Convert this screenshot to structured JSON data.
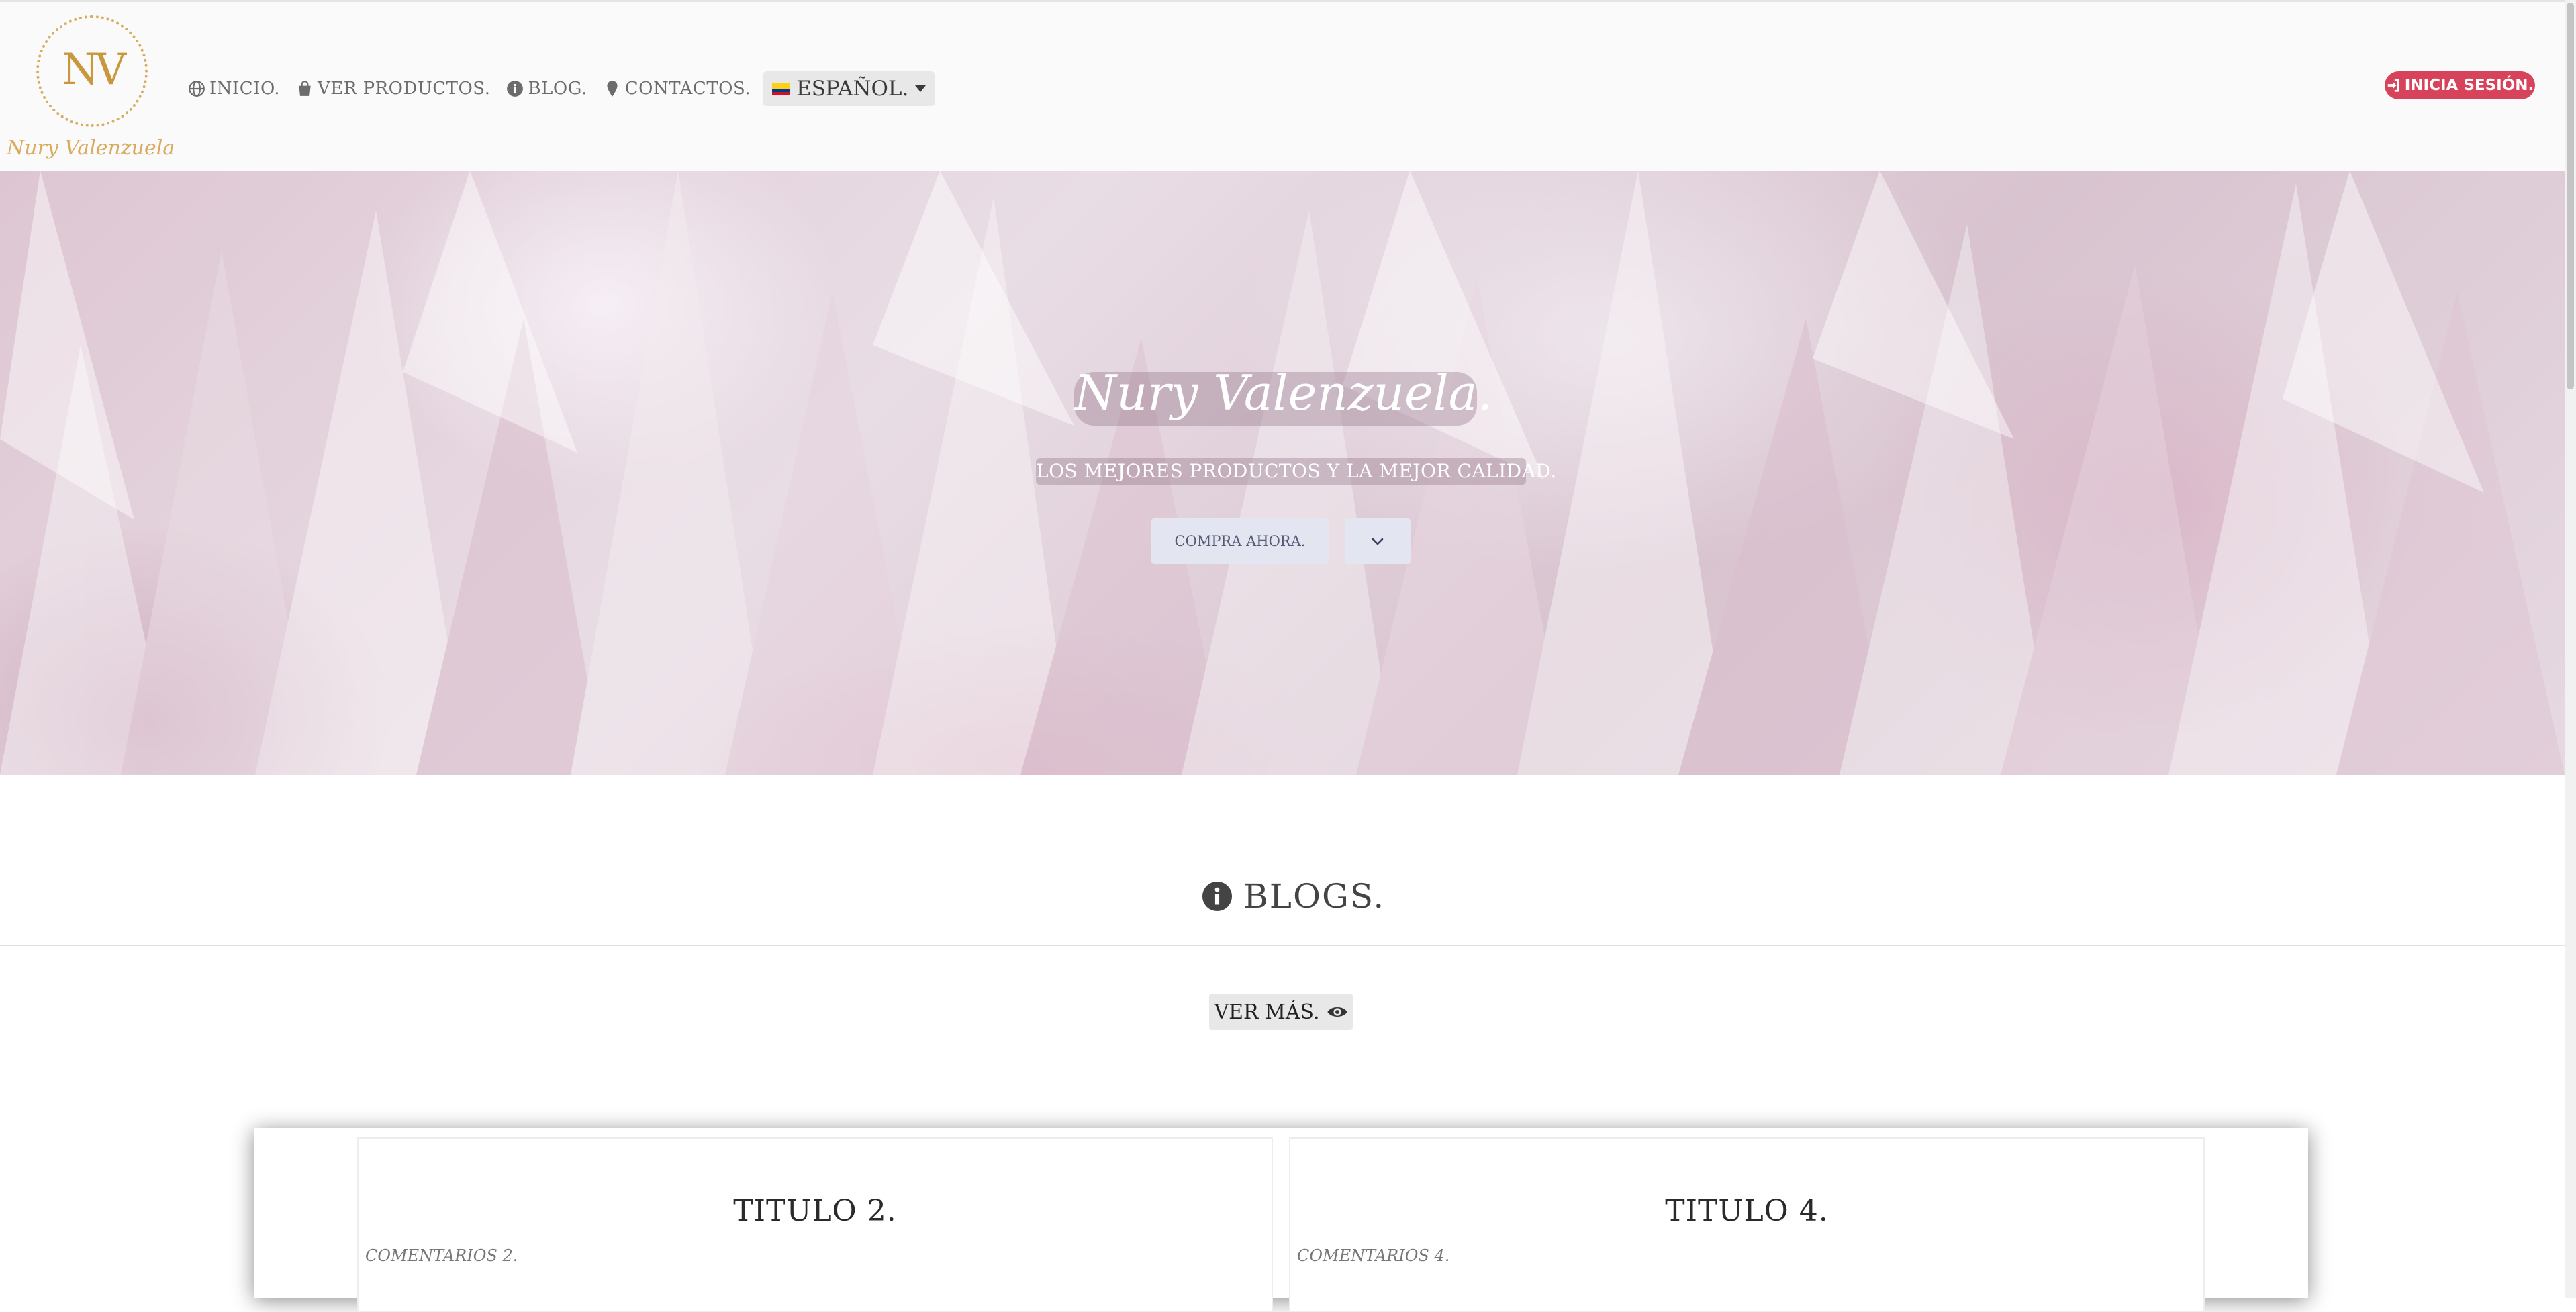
{
  "brand": {
    "monogram": "NV",
    "signature": "Nury Valenzuela"
  },
  "nav": {
    "items": [
      {
        "label": "Inicio.",
        "icon": "globe-icon"
      },
      {
        "label": "Ver productos.",
        "icon": "shopping-bag-icon"
      },
      {
        "label": "Blog.",
        "icon": "info-circle-icon"
      },
      {
        "label": "Contactos.",
        "icon": "map-marker-icon"
      }
    ],
    "language": {
      "label": "ESPAÑOL.",
      "flag": "colombia-flag"
    },
    "login_label": "INICIA SESIÓN."
  },
  "hero": {
    "title": "Nury Valenzuela.",
    "subtitle": "LOS MEJORES PRODUCTOS Y LA MEJOR CALIDAD.",
    "cta_label": "COMPRA AHORA.",
    "scroll_icon": "chevron-down-icon"
  },
  "blogs": {
    "heading": "BLOGS.",
    "more_label": "VER MÁS.",
    "posts": [
      {
        "title": "Titulo 2.",
        "comment": "Comentarios 2."
      },
      {
        "title": "Titulo 4.",
        "comment": "Comentarios 4."
      }
    ]
  },
  "colors": {
    "accent_red": "#d6435a",
    "logo_gold": "#c9973c",
    "navbar_bg": "#fafafa",
    "hero_pink": "#e0ccd7"
  }
}
